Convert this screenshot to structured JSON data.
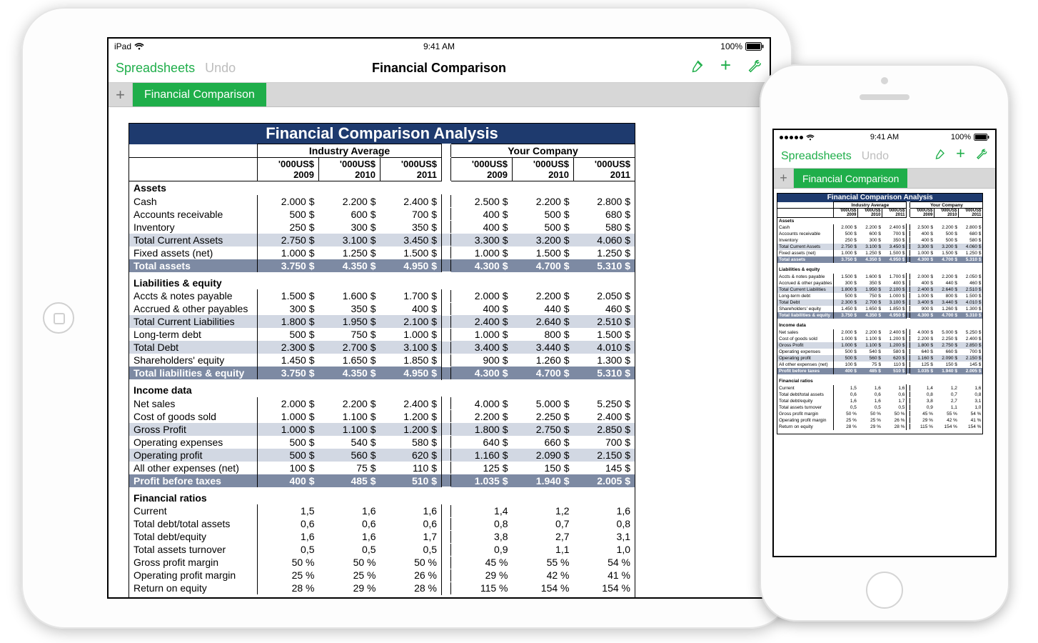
{
  "ipad": {
    "status": {
      "carrier": "iPad",
      "time": "9:41 AM",
      "battery": "100%"
    },
    "toolbar": {
      "back": "Spreadsheets",
      "undo": "Undo",
      "title": "Financial Comparison"
    },
    "tab": "Financial Comparison"
  },
  "iphone": {
    "status": {
      "time": "9:41 AM",
      "battery": "100%"
    },
    "toolbar": {
      "back": "Spreadsheets",
      "undo": "Undo"
    },
    "tab": "Financial Comparison"
  },
  "sheet": {
    "title": "Financial Comparison Analysis",
    "group_a": "Industry Average",
    "group_b": "Your Company",
    "unit_label": "'000US$",
    "years": [
      "2009",
      "2010",
      "2011"
    ],
    "sections": [
      {
        "name": "Assets",
        "rows": [
          {
            "label": "Cash",
            "a": [
              "2.000 $",
              "2.200 $",
              "2.400 $"
            ],
            "b": [
              "2.500 $",
              "2.200 $",
              "2.800 $"
            ]
          },
          {
            "label": "Accounts receivable",
            "a": [
              "500 $",
              "600 $",
              "700 $"
            ],
            "b": [
              "400 $",
              "500 $",
              "680 $"
            ]
          },
          {
            "label": "Inventory",
            "a": [
              "250 $",
              "300 $",
              "350 $"
            ],
            "b": [
              "400 $",
              "500 $",
              "580 $"
            ]
          },
          {
            "label": "Total Current Assets",
            "style": "sub",
            "a": [
              "2.750 $",
              "3.100 $",
              "3.450 $"
            ],
            "b": [
              "3.300 $",
              "3.200 $",
              "4.060 $"
            ]
          },
          {
            "label": "Fixed assets (net)",
            "a": [
              "1.000 $",
              "1.250 $",
              "1.500 $"
            ],
            "b": [
              "1.000 $",
              "1.500 $",
              "1.250 $"
            ]
          },
          {
            "label": "Total assets",
            "style": "total",
            "a": [
              "3.750 $",
              "4.350 $",
              "4.950 $"
            ],
            "b": [
              "4.300 $",
              "4.700 $",
              "5.310 $"
            ]
          }
        ]
      },
      {
        "name": "Liabilities & equity",
        "rows": [
          {
            "label": "Accts & notes payable",
            "a": [
              "1.500 $",
              "1.600 $",
              "1.700 $"
            ],
            "b": [
              "2.000 $",
              "2.200 $",
              "2.050 $"
            ]
          },
          {
            "label": "Accrued & other payables",
            "a": [
              "300 $",
              "350 $",
              "400 $"
            ],
            "b": [
              "400 $",
              "440 $",
              "460 $"
            ]
          },
          {
            "label": "Total Current Liabilities",
            "style": "sub",
            "a": [
              "1.800 $",
              "1.950 $",
              "2.100 $"
            ],
            "b": [
              "2.400 $",
              "2.640 $",
              "2.510 $"
            ]
          },
          {
            "label": "Long-term debt",
            "a": [
              "500 $",
              "750 $",
              "1.000 $"
            ],
            "b": [
              "1.000 $",
              "800 $",
              "1.500 $"
            ]
          },
          {
            "label": "Total Debt",
            "style": "sub",
            "a": [
              "2.300 $",
              "2.700 $",
              "3.100 $"
            ],
            "b": [
              "3.400 $",
              "3.440 $",
              "4.010 $"
            ]
          },
          {
            "label": "Shareholders' equity",
            "a": [
              "1.450 $",
              "1.650 $",
              "1.850 $"
            ],
            "b": [
              "900 $",
              "1.260 $",
              "1.300 $"
            ]
          },
          {
            "label": "Total liabilities & equity",
            "style": "total",
            "a": [
              "3.750 $",
              "4.350 $",
              "4.950 $"
            ],
            "b": [
              "4.300 $",
              "4.700 $",
              "5.310 $"
            ]
          }
        ]
      },
      {
        "name": "Income data",
        "rows": [
          {
            "label": "Net sales",
            "a": [
              "2.000 $",
              "2.200 $",
              "2.400 $"
            ],
            "b": [
              "4.000 $",
              "5.000 $",
              "5.250 $"
            ]
          },
          {
            "label": "Cost of goods sold",
            "a": [
              "1.000 $",
              "1.100 $",
              "1.200 $"
            ],
            "b": [
              "2.200 $",
              "2.250 $",
              "2.400 $"
            ]
          },
          {
            "label": "Gross Profit",
            "style": "sub",
            "a": [
              "1.000 $",
              "1.100 $",
              "1.200 $"
            ],
            "b": [
              "1.800 $",
              "2.750 $",
              "2.850 $"
            ]
          },
          {
            "label": "Operating expenses",
            "a": [
              "500 $",
              "540 $",
              "580 $"
            ],
            "b": [
              "640 $",
              "660 $",
              "700 $"
            ]
          },
          {
            "label": "Operating profit",
            "style": "sub",
            "a": [
              "500 $",
              "560 $",
              "620 $"
            ],
            "b": [
              "1.160 $",
              "2.090 $",
              "2.150 $"
            ]
          },
          {
            "label": "All other expenses (net)",
            "a": [
              "100 $",
              "75 $",
              "110 $"
            ],
            "b": [
              "125 $",
              "150 $",
              "145 $"
            ]
          },
          {
            "label": "Profit before taxes",
            "style": "total",
            "a": [
              "400 $",
              "485 $",
              "510 $"
            ],
            "b": [
              "1.035 $",
              "1.940 $",
              "2.005 $"
            ]
          }
        ]
      },
      {
        "name": "Financial ratios",
        "rows": [
          {
            "label": "Current",
            "a": [
              "1,5",
              "1,6",
              "1,6"
            ],
            "b": [
              "1,4",
              "1,2",
              "1,6"
            ]
          },
          {
            "label": "Total debt/total assets",
            "a": [
              "0,6",
              "0,6",
              "0,6"
            ],
            "b": [
              "0,8",
              "0,7",
              "0,8"
            ]
          },
          {
            "label": "Total debt/equity",
            "a": [
              "1,6",
              "1,6",
              "1,7"
            ],
            "b": [
              "3,8",
              "2,7",
              "3,1"
            ]
          },
          {
            "label": "Total assets turnover",
            "a": [
              "0,5",
              "0,5",
              "0,5"
            ],
            "b": [
              "0,9",
              "1,1",
              "1,0"
            ]
          },
          {
            "label": "Gross profit margin",
            "a": [
              "50 %",
              "50 %",
              "50 %"
            ],
            "b": [
              "45 %",
              "55 %",
              "54 %"
            ]
          },
          {
            "label": "Operating profit margin",
            "a": [
              "25 %",
              "25 %",
              "26 %"
            ],
            "b": [
              "29 %",
              "42 %",
              "41 %"
            ]
          },
          {
            "label": "Return on equity",
            "a": [
              "28 %",
              "29 %",
              "28 %"
            ],
            "b": [
              "115 %",
              "154 %",
              "154 %"
            ]
          }
        ]
      }
    ]
  }
}
